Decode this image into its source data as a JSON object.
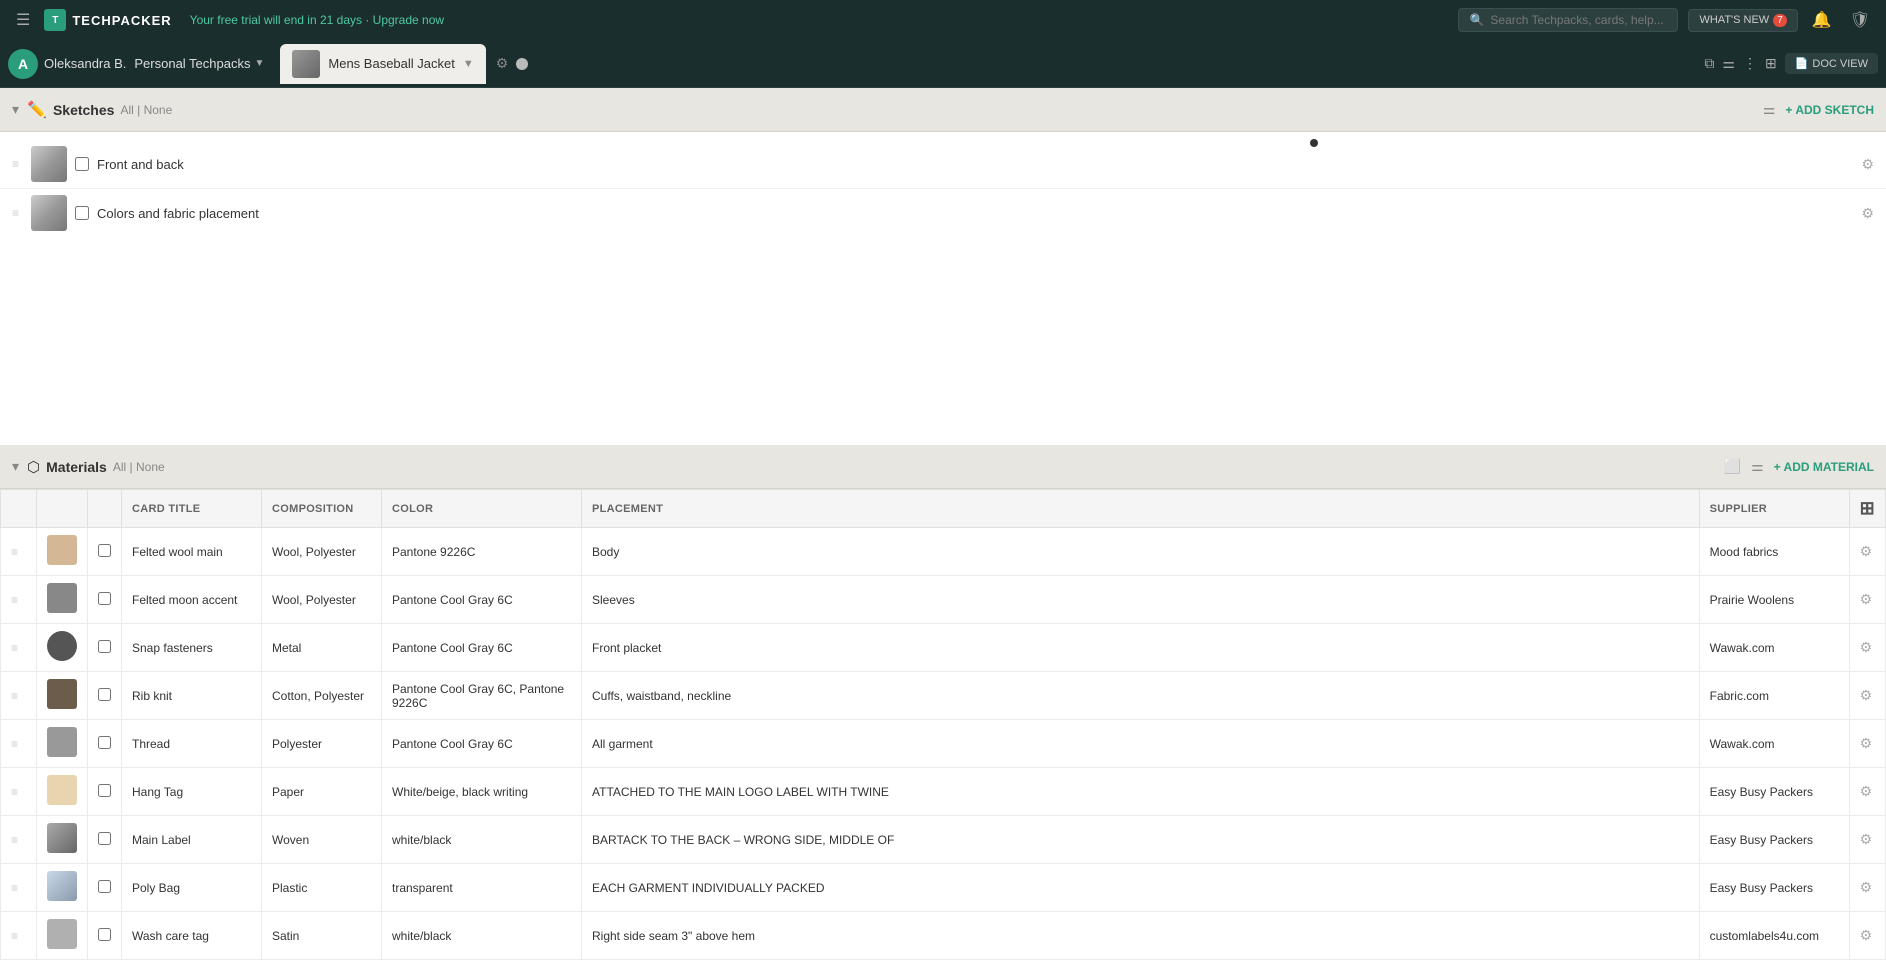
{
  "topNav": {
    "brandName": "TECHPACKER",
    "trialText": "Your free trial will end in 21 days ·",
    "upgradeLabel": "Upgrade now",
    "searchPlaceholder": "Search Techpacks, cards, help...",
    "whatsNew": "WHAT'S NEW",
    "whatsNewBadge": "7",
    "menuIcon": "☰",
    "gridIcon": "⊞"
  },
  "subNav": {
    "avatarLetter": "A",
    "userName": "Oleksandra B.",
    "techpackSelector": "Personal Techpacks",
    "productName": "Mens Baseball Jacket",
    "gearIcon": "⚙",
    "dotsIcon": "•••",
    "docViewLabel": "DOC VIEW",
    "rightIcons": [
      "copy",
      "filter",
      "more",
      "grid",
      "doc"
    ]
  },
  "sketches": {
    "sectionTitle": "Sketches",
    "filterAll": "All",
    "filterNone": "None",
    "addLabel": "+ ADD SKETCH",
    "items": [
      {
        "id": 1,
        "name": "Front and back",
        "checked": false
      },
      {
        "id": 2,
        "name": "Colors and fabric placement",
        "checked": false
      }
    ]
  },
  "materials": {
    "sectionTitle": "Materials",
    "filterAll": "All",
    "filterNone": "None",
    "addLabel": "+ ADD MATERIAL",
    "columns": {
      "title": "CARD TITLE",
      "composition": "COMPOSITION",
      "color": "COLOR",
      "placement": "PLACEMENT",
      "supplier": "SUPPLIER"
    },
    "rows": [
      {
        "name": "Felted wool main",
        "composition": "Wool, Polyester",
        "color": "Pantone 9226C",
        "placement": "Body",
        "supplier": "Mood fabrics",
        "swatchClass": "swatch-felted-main"
      },
      {
        "name": "Felted moon accent",
        "composition": "Wool, Polyester",
        "color": "Pantone Cool Gray 6C",
        "placement": "Sleeves",
        "supplier": "Prairie Woolens",
        "swatchClass": "swatch-felted-accent"
      },
      {
        "name": "Snap fasteners",
        "composition": "Metal",
        "color": "Pantone Cool Gray 6C",
        "placement": "Front placket",
        "supplier": "Wawak.com",
        "swatchClass": "swatch-snap"
      },
      {
        "name": "Rib knit",
        "composition": "Cotton, Polyester",
        "color": "Pantone Cool Gray 6C, Pantone 9226C",
        "placement": "Cuffs, waistband, neckline",
        "supplier": "Fabric.com",
        "swatchClass": "swatch-rib"
      },
      {
        "name": "Thread",
        "composition": "Polyester",
        "color": "Pantone Cool Gray 6C",
        "placement": "All garment",
        "supplier": "Wawak.com",
        "swatchClass": "swatch-thread"
      },
      {
        "name": "Hang Tag",
        "composition": "Paper",
        "color": "White/beige, black writing",
        "placement": "ATTACHED TO THE MAIN LOGO LABEL WITH TWINE",
        "supplier": "Easy Busy Packers",
        "swatchClass": "swatch-hang"
      },
      {
        "name": "Main Label",
        "composition": "Woven",
        "color": "white/black",
        "placement": "BARTACK TO THE BACK – WRONG SIDE, MIDDLE OF",
        "supplier": "Easy Busy Packers",
        "swatchClass": "swatch-label"
      },
      {
        "name": "Poly Bag",
        "composition": "Plastic",
        "color": "transparent",
        "placement": "EACH GARMENT INDIVIDUALLY PACKED",
        "supplier": "Easy Busy Packers",
        "swatchClass": "swatch-poly"
      },
      {
        "name": "Wash care tag",
        "composition": "Satin",
        "color": "white/black",
        "placement": "Right side seam 3\" above hem",
        "supplier": "customlabels4u.com",
        "swatchClass": "swatch-wash"
      }
    ]
  }
}
